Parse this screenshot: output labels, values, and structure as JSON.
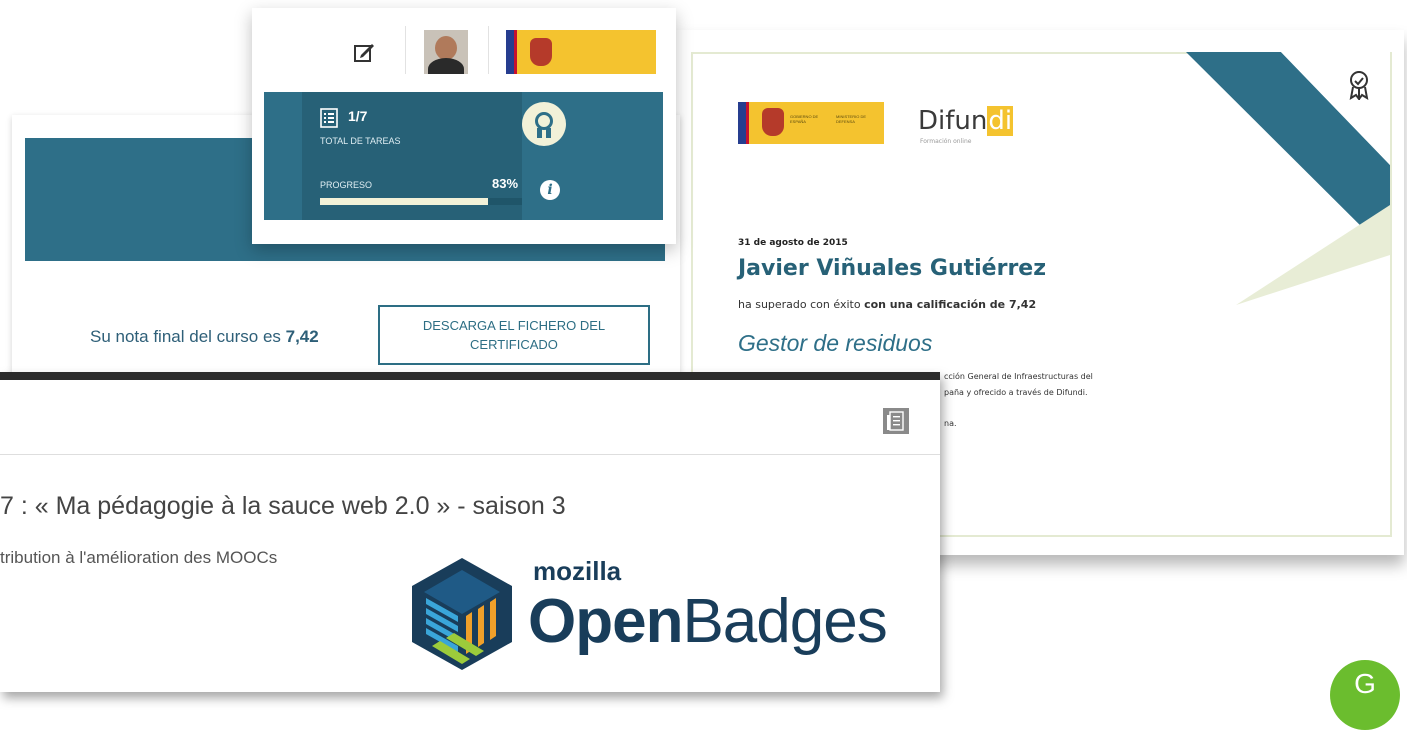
{
  "progress_panel": {
    "tasks_count": "1/7",
    "tasks_label": "TOTAL DE TAREAS",
    "progress_label": "PROGRESO",
    "progress_value": "83%",
    "progress_fraction": 0.83,
    "edit_icon": "edit-icon",
    "info_icon": "info-icon",
    "award_icon": "award-ribbon-icon"
  },
  "course_result": {
    "final_grade_prefix": "Su nota final del curso es ",
    "final_grade_value": "7,42",
    "download_label_line1": "DESCARGA EL FICHERO DEL",
    "download_label_line2": "CERTIFICADO"
  },
  "certificate": {
    "brand_prefix": "Difun",
    "brand_highlight": "di",
    "brand_subtitle": "Formación online",
    "date": "31 de agosto de 2015",
    "recipient": "Javier Viñuales Gutiérrez",
    "achievement_prefix": "ha superado con éxito ",
    "achievement_bold": "con una calificación de 7,42",
    "course_name": "Gestor de residuos",
    "body_line1": "cción General de Infraestructuras del",
    "body_line2": "paña y ofrecido a través de Difundi.",
    "body_line3": "na.",
    "gov_logo_line1": "GOBIERNO DE ESPAÑA",
    "gov_logo_line2": "MINISTERIO DE DEFENSA"
  },
  "badges_window": {
    "course_title": "7 : « Ma pédagogie à la sauce web 2.0 » - saison 3",
    "badge_subtitle": "tribution à l'amélioration des MOOCs",
    "mozilla_label": "mozilla",
    "open_label": "Open",
    "badges_label": "Badges"
  },
  "floating_button": {
    "label": "G"
  },
  "colors": {
    "teal": "#2e6f88",
    "teal_dark": "#276177",
    "gov_yellow": "#f4c32f",
    "openbadges_navy": "#193d5a",
    "openbadges_green": "#9ccb3b",
    "fab_green": "#6bbd2e"
  }
}
